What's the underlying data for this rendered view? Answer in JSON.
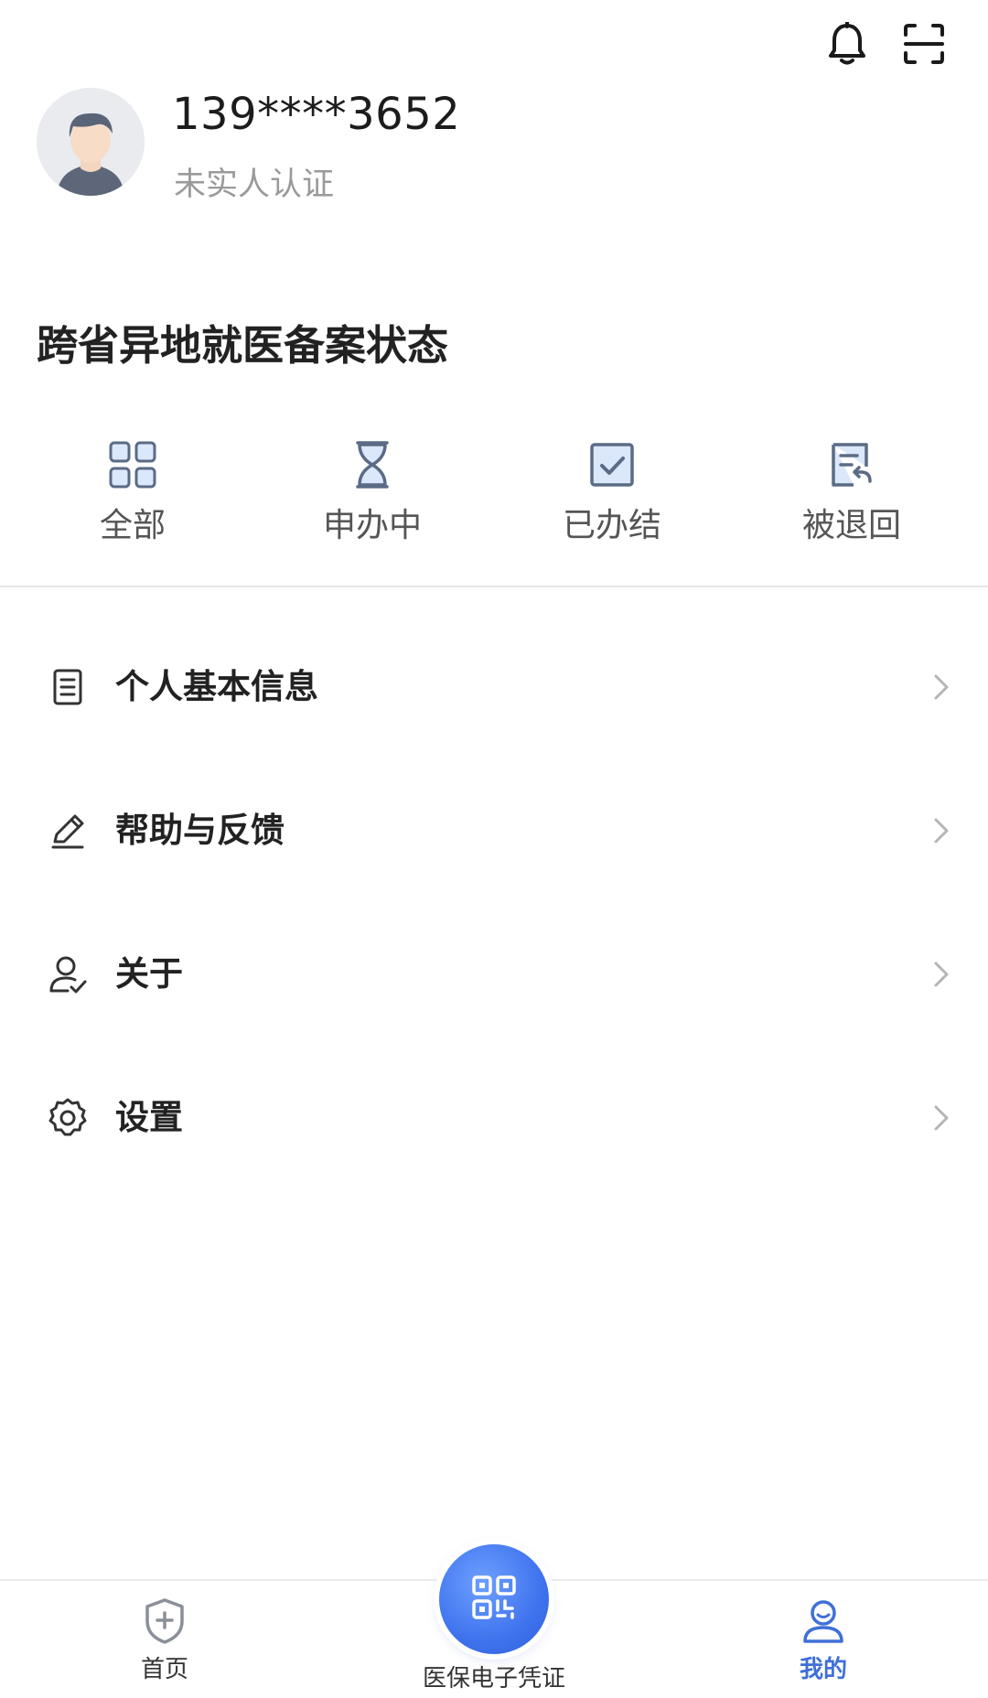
{
  "header": {
    "bell_icon": "bell-icon",
    "scan_icon": "scan-icon"
  },
  "profile": {
    "phone": "139****3652",
    "verification_status": "未实人认证",
    "avatar_icon": "avatar"
  },
  "filing_status": {
    "title": "跨省异地就医备案状态",
    "items": [
      {
        "label": "全部",
        "icon": "grid-icon"
      },
      {
        "label": "申办中",
        "icon": "hourglass-icon"
      },
      {
        "label": "已办结",
        "icon": "check-square-icon"
      },
      {
        "label": "被退回",
        "icon": "document-return-icon"
      }
    ]
  },
  "menu": {
    "items": [
      {
        "label": "个人基本信息",
        "icon": "document-list-icon"
      },
      {
        "label": "帮助与反馈",
        "icon": "pencil-icon"
      },
      {
        "label": "关于",
        "icon": "user-check-icon"
      },
      {
        "label": "设置",
        "icon": "gear-icon"
      }
    ]
  },
  "bottom_nav": {
    "home_label": "首页",
    "qr_label": "医保电子凭证",
    "me_label": "我的",
    "accent_color": "#3f6fd8"
  }
}
